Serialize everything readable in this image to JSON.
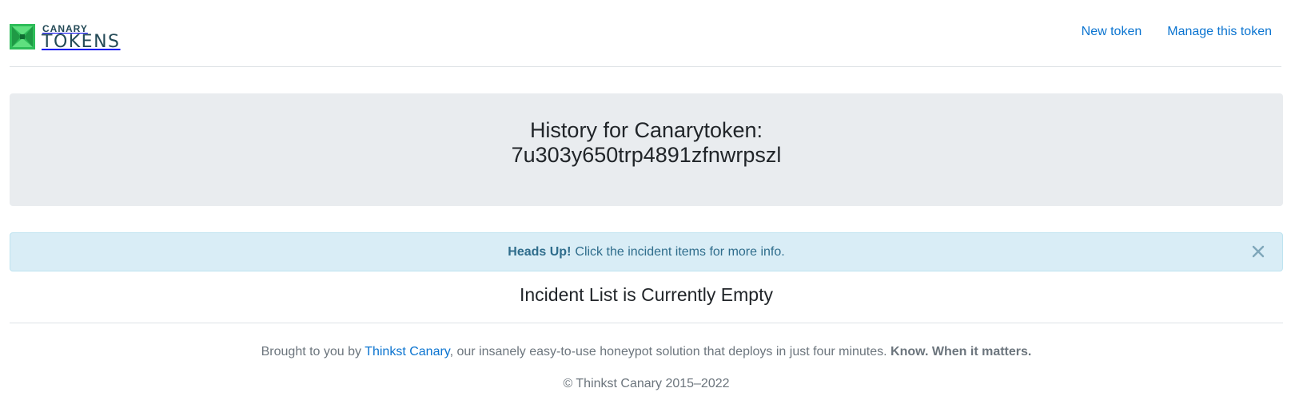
{
  "brand": {
    "small": "CANARY",
    "big": "TOKENS",
    "colors": {
      "mark_green": "#2ebd59",
      "mark_light": "#5fe07f",
      "text": "#244a57"
    }
  },
  "nav": {
    "new_token": "New token",
    "manage_token": "Manage this token"
  },
  "jumbotron": {
    "line1": "History for Canarytoken:",
    "token_id": "7u303y650trp4891zfnwrpszl"
  },
  "alert": {
    "strong": "Heads Up!",
    "text": "Click the incident items for more info.",
    "close_icon": "close-icon"
  },
  "incidents": {
    "empty_message": "Incident List is Currently Empty"
  },
  "footer": {
    "prefix": "Brought to you by",
    "link_text": "Thinkst Canary",
    "middle": ", our insanely easy-to-use honeypot solution that deploys in just four minutes.",
    "tagline": "Know. When it matters.",
    "copyright": "© Thinkst Canary 2015–2022"
  },
  "colors": {
    "link": "#0b74d0",
    "jumbotron_bg": "#e9ecef",
    "alert_bg": "#d9edf6",
    "alert_text": "#2f6d8c",
    "muted": "#6c757d"
  }
}
